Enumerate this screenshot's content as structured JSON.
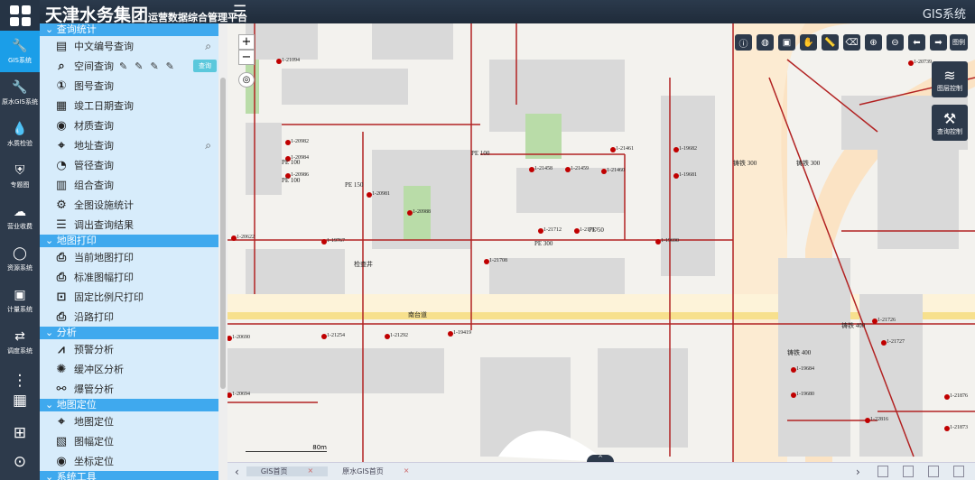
{
  "header": {
    "brand": "天津水务集团",
    "subtitle": "运营数据综合管理平台",
    "system_title": "GIS系统"
  },
  "rail": [
    {
      "label": "GIS系统",
      "icon": "wrench-icon",
      "active": true
    },
    {
      "label": "原水GIS系统",
      "icon": "wrench-icon"
    },
    {
      "label": "水质检验",
      "icon": "water-drop-icon"
    },
    {
      "label": "专题图",
      "icon": "shield-icon"
    },
    {
      "label": "营业收费",
      "icon": "cloud-icon"
    },
    {
      "label": "资源系统",
      "icon": "circle-icon"
    },
    {
      "label": "计量系统",
      "icon": "meter-icon"
    },
    {
      "label": "调度系统",
      "icon": "dispatch-icon"
    }
  ],
  "panel": {
    "sections": [
      {
        "title": "查询统计",
        "items": [
          {
            "label": "中文编号查询",
            "icon": "doc-search-icon",
            "right": "search"
          },
          {
            "label": "空间查询",
            "icon": "space-search-icon",
            "tools": true
          },
          {
            "label": "图号查询",
            "icon": "map-number-icon"
          },
          {
            "label": "竣工日期查询",
            "icon": "calendar-icon"
          },
          {
            "label": "材质查询",
            "icon": "material-icon"
          },
          {
            "label": "地址查询",
            "icon": "address-icon",
            "right": "search"
          },
          {
            "label": "管径查询",
            "icon": "diameter-icon"
          },
          {
            "label": "组合查询",
            "icon": "combo-icon"
          },
          {
            "label": "全图设施统计",
            "icon": "stats-icon"
          },
          {
            "label": "调出查询结果",
            "icon": "list-icon"
          }
        ]
      },
      {
        "title": "地图打印",
        "items": [
          {
            "label": "当前地图打印",
            "icon": "printer-icon"
          },
          {
            "label": "标准图幅打印",
            "icon": "printer-icon"
          },
          {
            "label": "固定比例尺打印",
            "icon": "scale-print-icon"
          },
          {
            "label": "沿路打印",
            "icon": "printer-icon"
          }
        ]
      },
      {
        "title": "分析",
        "items": [
          {
            "label": "预警分析",
            "icon": "chart-icon"
          },
          {
            "label": "缓冲区分析",
            "icon": "buffer-icon"
          },
          {
            "label": "爆管分析",
            "icon": "burst-icon"
          }
        ]
      },
      {
        "title": "地图定位",
        "items": [
          {
            "label": "地图定位",
            "icon": "map-pin-icon"
          },
          {
            "label": "图幅定位",
            "icon": "sheet-icon"
          },
          {
            "label": "坐标定位",
            "icon": "target-icon"
          }
        ]
      },
      {
        "title": "系统工具",
        "items": []
      }
    ],
    "query_button": "查询"
  },
  "map": {
    "tools": [
      "info",
      "globe",
      "archive",
      "hand",
      "ruler",
      "eraser",
      "zoom-in",
      "zoom-out",
      "back",
      "forward"
    ],
    "legend_button": "图例",
    "layer_control": "图层控制",
    "query_control": "查询控制",
    "scale": "80m",
    "labels": [
      "PE 100",
      "PE 100",
      "PE 100",
      "PE 150",
      "PE 50",
      "PE 300",
      "铸铁 300",
      "铸铁 300",
      "铸铁 400",
      "铸铁 400",
      "检查井",
      "南台道",
      "1-21094",
      "1-20982",
      "1-20984",
      "1-20986",
      "1-20981",
      "1-20988",
      "1-21458",
      "1-21459",
      "1-21460",
      "1-21461",
      "1-19682",
      "1-19681",
      "1-19684",
      "1-19680",
      "1-21726",
      "1-21727",
      "1-20739",
      "1-21712",
      "1-21713",
      "1-21708",
      "1-19767",
      "1-20622",
      "1-21254",
      "1-21292",
      "1-19419",
      "1-19690",
      "1-20690",
      "1-20694",
      "1-21876",
      "1-21873",
      "1-22816"
    ]
  },
  "tabs": [
    {
      "label": "GIS首页",
      "active": true
    },
    {
      "label": "原水GIS首页"
    }
  ]
}
